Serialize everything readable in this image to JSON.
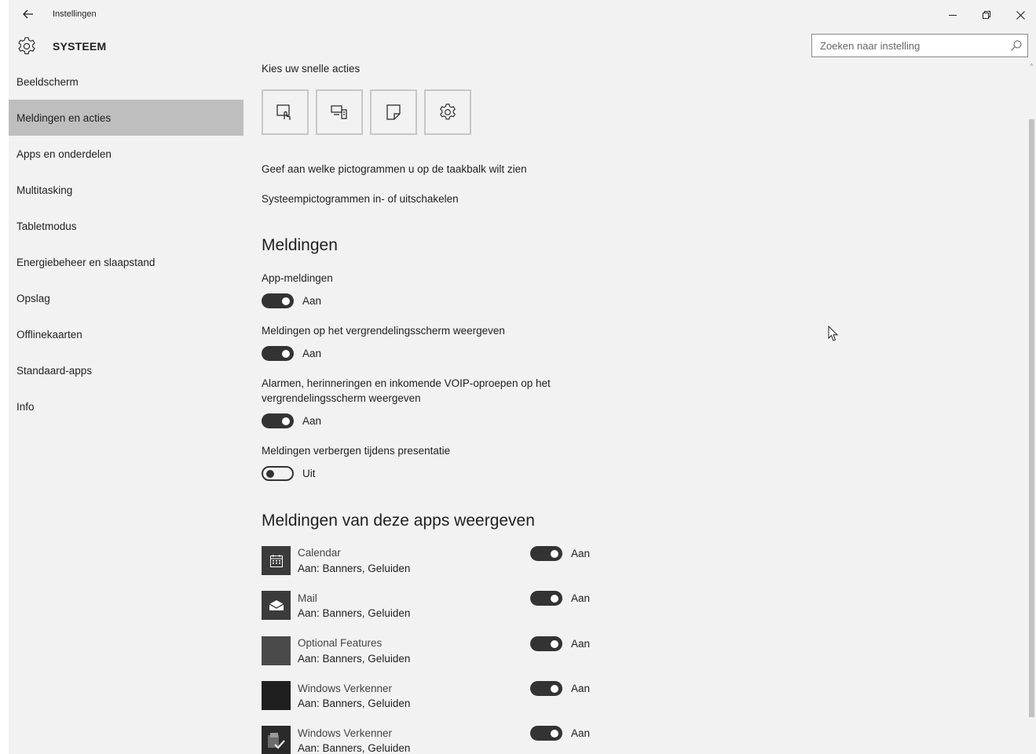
{
  "titlebar": {
    "back_icon": "arrow-left-icon",
    "app_title": "Instellingen",
    "minimize": "–",
    "restore": "⧉",
    "close": "✕"
  },
  "header": {
    "title": "SYSTEEM",
    "search_placeholder": "Zoeken naar instelling"
  },
  "sidebar": {
    "items": [
      {
        "label": "Beeldscherm"
      },
      {
        "label": "Meldingen en acties",
        "active": true
      },
      {
        "label": "Apps en onderdelen"
      },
      {
        "label": "Multitasking"
      },
      {
        "label": "Tabletmodus"
      },
      {
        "label": "Energiebeheer en slaapstand"
      },
      {
        "label": "Opslag"
      },
      {
        "label": "Offlinekaarten"
      },
      {
        "label": "Standaard-apps"
      },
      {
        "label": "Info"
      }
    ]
  },
  "quick_actions": {
    "heading": "Kies uw snelle acties",
    "tiles": [
      "tablet-mode-icon",
      "project-icon",
      "note-icon",
      "settings-icon"
    ],
    "taskbar_link": "Geef aan welke pictogrammen u op de taakbalk wilt zien",
    "system_icons_link": "Systeempictogrammen in- of uitschakelen"
  },
  "notifications": {
    "heading": "Meldingen",
    "settings": [
      {
        "label": "App-meldingen",
        "state": "Aan",
        "on": true
      },
      {
        "label": "Meldingen op het vergrendelingsscherm weergeven",
        "state": "Aan",
        "on": true
      },
      {
        "label_line1": "Alarmen, herinneringen en inkomende VOIP-oproepen op het",
        "label_line2": "vergrendelingsscherm weergeven",
        "state": "Aan",
        "on": true
      },
      {
        "label": "Meldingen verbergen tijdens presentatie",
        "state": "Uit",
        "on": false
      }
    ]
  },
  "apps": {
    "heading": "Meldingen van deze apps weergeven",
    "list": [
      {
        "name": "Calendar",
        "detail": "Aan: Banners, Geluiden",
        "state": "Aan",
        "icon": "calendar-icon"
      },
      {
        "name": "Mail",
        "detail": "Aan: Banners, Geluiden",
        "state": "Aan",
        "icon": "mail-icon"
      },
      {
        "name": "Optional Features",
        "detail": "Aan: Banners, Geluiden",
        "state": "Aan",
        "icon": "optional-features-icon"
      },
      {
        "name": "Windows Verkenner",
        "detail": "Aan: Banners, Geluiden",
        "state": "Aan",
        "icon": "explorer-icon"
      },
      {
        "name": "Windows Verkenner",
        "detail": "Aan: Banners, Geluiden",
        "state": "Aan",
        "icon": "explorer-check-icon"
      }
    ]
  }
}
